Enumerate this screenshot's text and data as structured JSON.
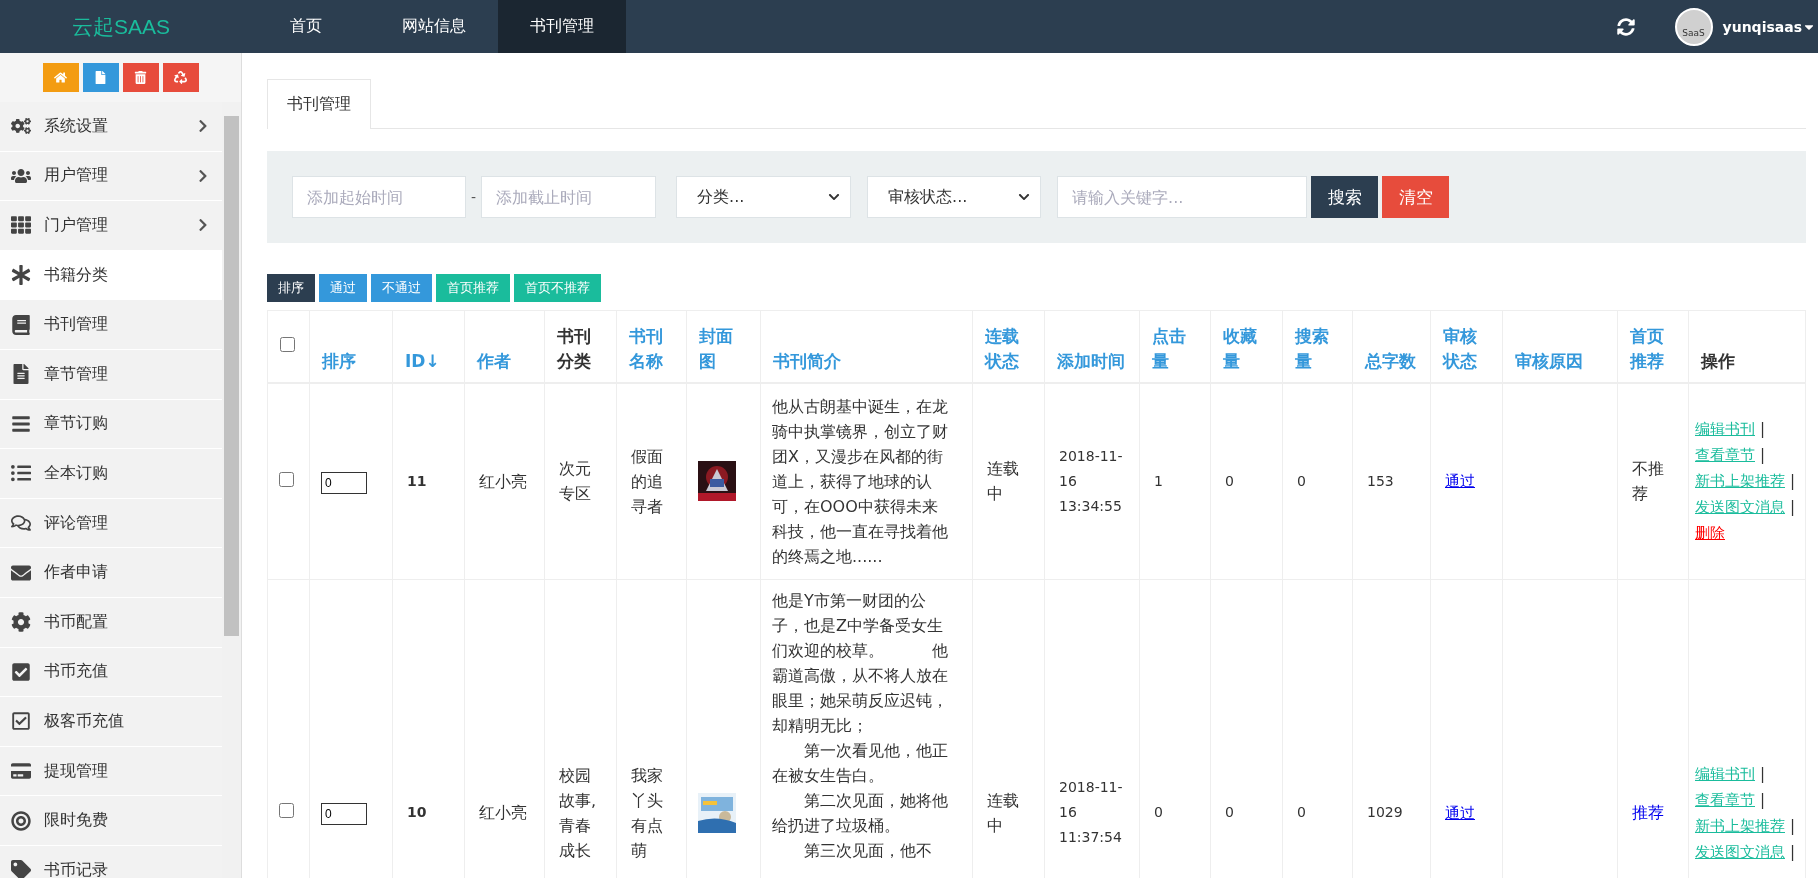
{
  "topbar": {
    "logo": "云起SAAS",
    "nav": [
      {
        "label": "首页",
        "selected": false
      },
      {
        "label": "网站信息",
        "selected": false
      },
      {
        "label": "书刊管理",
        "selected": true
      }
    ],
    "avatar_text": "SaaS",
    "username": "yunqisaas"
  },
  "sidebar": {
    "tools": [
      {
        "kind": "home"
      },
      {
        "kind": "file"
      },
      {
        "kind": "trash"
      },
      {
        "kind": "recycle"
      }
    ],
    "items": [
      {
        "kind": "cogs",
        "label": "系统设置",
        "expandable": true,
        "selected": false
      },
      {
        "kind": "users",
        "label": "用户管理",
        "expandable": true,
        "selected": false
      },
      {
        "kind": "grid",
        "label": "门户管理",
        "expandable": true,
        "selected": false
      },
      {
        "kind": "asterisk",
        "label": "书籍分类",
        "expandable": false,
        "selected": true
      },
      {
        "kind": "book",
        "label": "书刊管理",
        "expandable": false,
        "selected": false
      },
      {
        "kind": "file",
        "label": "章节管理",
        "expandable": false,
        "selected": false
      },
      {
        "kind": "bars",
        "label": "章节订购",
        "expandable": false,
        "selected": false
      },
      {
        "kind": "list",
        "label": "全本订购",
        "expandable": false,
        "selected": false
      },
      {
        "kind": "comments",
        "label": "评论管理",
        "expandable": false,
        "selected": false
      },
      {
        "kind": "envelope",
        "label": "作者申请",
        "expandable": false,
        "selected": false
      },
      {
        "kind": "cog",
        "label": "书币配置",
        "expandable": false,
        "selected": false
      },
      {
        "kind": "checksquare",
        "label": "书币充值",
        "expandable": false,
        "selected": false
      },
      {
        "kind": "checkoutline",
        "label": "极客币充值",
        "expandable": false,
        "selected": false
      },
      {
        "kind": "card",
        "label": "提现管理",
        "expandable": false,
        "selected": false
      },
      {
        "kind": "bullseye",
        "label": "限时免费",
        "expandable": false,
        "selected": false
      },
      {
        "kind": "tag",
        "label": "书币记录",
        "expandable": false,
        "selected": false
      }
    ]
  },
  "tabs": [
    {
      "label": "书刊管理",
      "selected": true
    }
  ],
  "filters": {
    "start_date": {
      "placeholder": "添加起始时间"
    },
    "dash": "-",
    "end_date": {
      "placeholder": "添加截止时间"
    },
    "category": {
      "value": "分类..."
    },
    "audit": {
      "value": "审核状态..."
    },
    "keyword": {
      "placeholder": "请输入关键字..."
    },
    "buttons": [
      {
        "label": "搜索",
        "kind": "dark"
      },
      {
        "label": "清空",
        "kind": "danger"
      }
    ]
  },
  "bulk_actions": [
    {
      "label": "排序",
      "kind": "dark"
    },
    {
      "label": "通过",
      "kind": "blue"
    },
    {
      "label": "不通过",
      "kind": "blue"
    },
    {
      "label": "首页推荐",
      "kind": "green"
    },
    {
      "label": "首页不推荐",
      "kind": "green"
    }
  ],
  "table": {
    "select_all": {
      "checked": false
    },
    "columns": [
      {
        "label": "排序",
        "sortable": true
      },
      {
        "label": "ID↓",
        "sortable": true
      },
      {
        "label": "作者",
        "sortable": true
      },
      {
        "label": "书刊分类",
        "sortable": false
      },
      {
        "label": "书刊名称",
        "sortable": true
      },
      {
        "label": "封面图",
        "sortable": true
      },
      {
        "label": "书刊简介",
        "sortable": true
      },
      {
        "label": "连载状态",
        "sortable": true
      },
      {
        "label": "添加时间",
        "sortable": true
      },
      {
        "label": "点击量",
        "sortable": true
      },
      {
        "label": "收藏量",
        "sortable": true
      },
      {
        "label": "搜索量",
        "sortable": true
      },
      {
        "label": "总字数",
        "sortable": true
      },
      {
        "label": "审核状态",
        "sortable": true
      },
      {
        "label": "审核原因",
        "sortable": true
      },
      {
        "label": "首页推荐",
        "sortable": true
      },
      {
        "label": "操作",
        "sortable": false
      }
    ],
    "rows": [
      {
        "checked": false,
        "order": "0",
        "id": "11",
        "author": "红小亮",
        "category": "次元专区",
        "name": "假面的追寻者",
        "cover": {
          "kind": "picture"
        },
        "intro": [
          "他从古朗基中诞生，在龙骑中执掌镜界，创立了财团X，又漫步在风都的街道上，获得了地球的认可，在OOO中获得未来科技，他一直在寻找着他的终焉之地......"
        ],
        "status": "连载中",
        "added": "2018-11-16 13:34:55",
        "clicks": "1",
        "favorites": "0",
        "searches": "0",
        "words": "153",
        "audit": "通过",
        "recommend": {
          "label": "不推荐",
          "on": false
        },
        "actions": [
          {
            "label": "编辑书刊",
            "kind": "link"
          },
          {
            "label": "查看章节",
            "kind": "link"
          },
          {
            "label": "新书上架推荐",
            "kind": "link"
          },
          {
            "label": "发送图文消息",
            "kind": "link"
          },
          {
            "label": "删除",
            "kind": "delete"
          }
        ]
      },
      {
        "checked": false,
        "order": "0",
        "id": "10",
        "author": "红小亮",
        "category": "校园故事,青春成长",
        "name": "我家丫头有点萌",
        "cover": {
          "kind": "picture"
        },
        "intro": [
          "他是Y市第一财团的公子，也是Z中学备受女生们欢迎的校草。　　　他霸道高傲，从不将人放在眼里；她呆萌反应迟钝，却精明无比；",
          "　　第一次看见他，他正在被女生告白。",
          "　　第二次见面，她将他给扔进了垃圾桶。",
          "　　第三次见面，他不"
        ],
        "status": "连载中",
        "added": "2018-11-16 11:37:54",
        "clicks": "0",
        "favorites": "0",
        "searches": "0",
        "words": "1029",
        "audit": "通过",
        "recommend": {
          "label": "推荐",
          "on": true
        },
        "actions": [
          {
            "label": "编辑书刊",
            "kind": "link"
          },
          {
            "label": "查看章节",
            "kind": "link"
          },
          {
            "label": "新书上架推荐",
            "kind": "link"
          },
          {
            "label": "发送图文消息",
            "kind": "link"
          }
        ]
      }
    ],
    "separator": "|"
  }
}
